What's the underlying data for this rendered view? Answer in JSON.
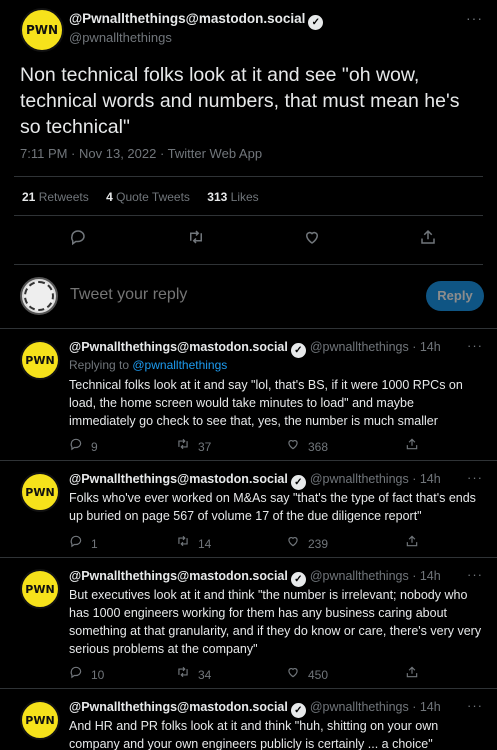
{
  "main_tweet": {
    "display_name": "@Pwnallthethings@mastodon.social",
    "handle": "@pwnallthethings",
    "avatar_text": "PWN",
    "body": "Non technical folks look at it and see \"oh wow, technical words and numbers, that must mean he's so technical\"",
    "meta": "7:11 PM · Nov 13, 2022 · Twitter Web App",
    "stats": {
      "retweets_count": "21",
      "retweets_label": "Retweets",
      "quotes_count": "4",
      "quotes_label": "Quote Tweets",
      "likes_count": "313",
      "likes_label": "Likes"
    },
    "more": "···"
  },
  "icons": {
    "reply": "comment-icon",
    "retweet": "retweet-icon",
    "like": "heart-icon",
    "share": "share-icon"
  },
  "reply_box": {
    "placeholder": "Tweet your reply",
    "button_label": "Reply"
  },
  "replies": [
    {
      "display_name": "@Pwnallthethings@mastodon.social",
      "meta": "@pwnallthethings · 14h",
      "replying_to_prefix": "Replying to ",
      "replying_to_handle": "@pwnallthethings",
      "text": "Technical folks look at it and say \"lol, that's BS, if it were 1000 RPCs on load, the home screen would take minutes to load\" and maybe immediately go check to see that, yes, the number is much smaller",
      "replies": "9",
      "retweets": "37",
      "likes": "368"
    },
    {
      "display_name": "@Pwnallthethings@mastodon.social",
      "meta": "@pwnallthethings · 14h",
      "text": "Folks who've ever worked on M&As say \"that's the type of fact that's ends up buried on page 567 of volume 17 of the due diligence report\"",
      "replies": "1",
      "retweets": "14",
      "likes": "239"
    },
    {
      "display_name": "@Pwnallthethings@mastodon.social",
      "meta": "@pwnallthethings · 14h",
      "text": "But executives look at it and think \"the number is irrelevant; nobody who has 1000 engineers working for them has any business caring about something at that granularity, and if they do know or care, there's very very serious problems at the company\"",
      "replies": "10",
      "retweets": "34",
      "likes": "450"
    },
    {
      "display_name": "@Pwnallthethings@mastodon.social",
      "meta": "@pwnallthethings · 14h",
      "text": "And HR and PR folks look at it and think \"huh, shitting on your own company and your own engineers publicly is certainly ... a choice\""
    }
  ],
  "colors": {
    "background": "#000000",
    "accent": "#1d9bf0",
    "muted": "#71767b",
    "avatar": "#f6e21b"
  }
}
